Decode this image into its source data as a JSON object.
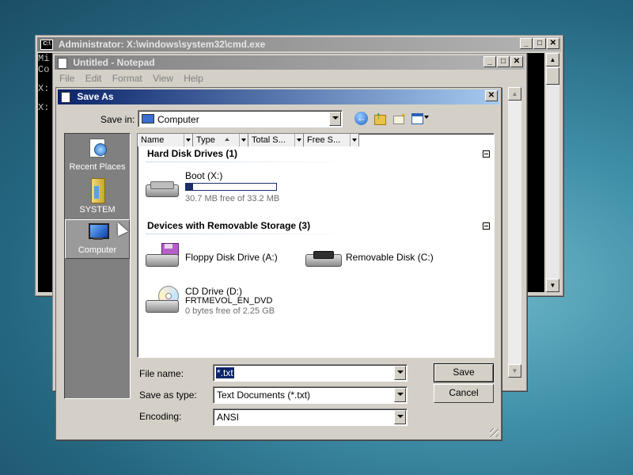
{
  "cmd": {
    "title": "Administrator: X:\\windows\\system32\\cmd.exe",
    "lines": [
      "Mi",
      "Co",
      "",
      "X:",
      "",
      "X:"
    ]
  },
  "notepad": {
    "title": "Untitled - Notepad",
    "menu": [
      "File",
      "Edit",
      "Format",
      "View",
      "Help"
    ]
  },
  "dialog": {
    "title": "Save As",
    "save_in_label": "Save in:",
    "save_in_value": "Computer",
    "places": [
      {
        "label": "Recent Places",
        "icon": "recent-places-icon"
      },
      {
        "label": "SYSTEM",
        "icon": "folder-icon"
      },
      {
        "label": "Computer",
        "icon": "computer-icon"
      }
    ],
    "columns": [
      "Name",
      "Type",
      "Total S...",
      "Free S..."
    ],
    "groups": [
      {
        "header": "Hard Disk Drives (1)",
        "items": [
          {
            "name": "Boot (X:)",
            "detail": "30.7 MB free of 33.2 MB",
            "used_fraction": 0.08,
            "icon": "hard-disk-icon"
          }
        ]
      },
      {
        "header": "Devices with Removable Storage (3)",
        "items": [
          {
            "name": "Floppy Disk Drive (A:)",
            "icon": "floppy-drive-icon"
          },
          {
            "name": "Removable Disk (C:)",
            "icon": "removable-disk-icon"
          },
          {
            "name": "CD Drive (D:)",
            "label2": "FRTMEVOL_EN_DVD",
            "detail": "0 bytes free of 2.25 GB",
            "icon": "cd-drive-icon"
          }
        ]
      }
    ],
    "file_name_label": "File name:",
    "file_name_value": "*.txt",
    "save_type_label": "Save as type:",
    "save_type_value": "Text Documents (*.txt)",
    "encoding_label": "Encoding:",
    "encoding_value": "ANSI",
    "save_button": "Save",
    "cancel_button": "Cancel"
  }
}
